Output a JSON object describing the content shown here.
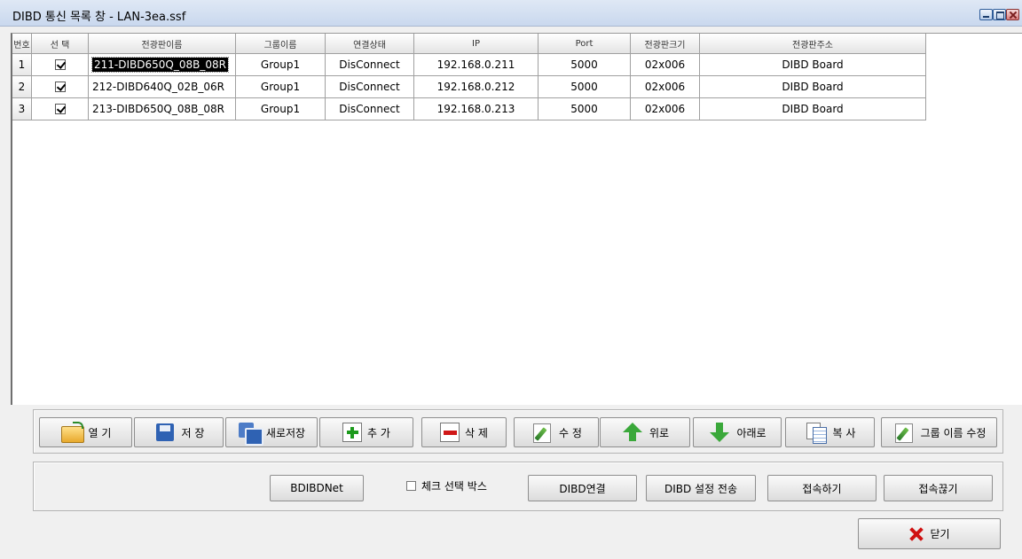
{
  "window": {
    "title": "DIBD 통신 목록 창 - LAN-3ea.ssf"
  },
  "grid": {
    "headers": [
      "번호",
      "선 택",
      "전광판이름",
      "그룹이름",
      "연결상태",
      "IP",
      "Port",
      "전광판크기",
      "전광판주소"
    ],
    "rows": [
      {
        "num": "1",
        "checked": true,
        "name": "211-DIBD650Q_08B_08R",
        "group": "Group1",
        "status": "DisConnect",
        "ip": "192.168.0.211",
        "port": "5000",
        "size": "02x006",
        "address": "DIBD Board"
      },
      {
        "num": "2",
        "checked": true,
        "name": "212-DIBD640Q_02B_06R",
        "group": "Group1",
        "status": "DisConnect",
        "ip": "192.168.0.212",
        "port": "5000",
        "size": "02x006",
        "address": "DIBD Board"
      },
      {
        "num": "3",
        "checked": true,
        "name": "213-DIBD650Q_08B_08R",
        "group": "Group1",
        "status": "DisConnect",
        "ip": "192.168.0.213",
        "port": "5000",
        "size": "02x006",
        "address": "DIBD Board"
      }
    ]
  },
  "toolbar": {
    "open": "열  기",
    "save": "저  장",
    "save_as": "새로저장",
    "add": "추  가",
    "delete": "삭  제",
    "edit": "수  정",
    "move_up": "위로",
    "move_down": "아래로",
    "copy": "복  사",
    "rename_group": "그룹 이름 수정"
  },
  "actions": {
    "bdibdnet": "BDIBDNet",
    "check_select_box": "체크 선택 박스",
    "dibd_connect": "DIBD연결",
    "dibd_send_settings": "DIBD 설정 전송",
    "connect": "접속하기",
    "disconnect": "접속끊기"
  },
  "footer": {
    "close": "닫기"
  }
}
